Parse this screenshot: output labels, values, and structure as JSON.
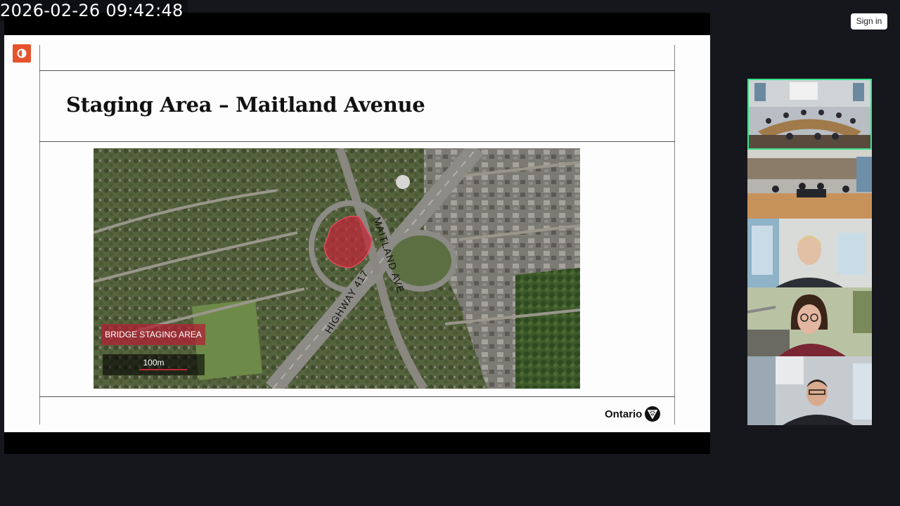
{
  "timestamp": "2026-02-26 09:42:48",
  "header": {
    "sign_in_label": "Sign in"
  },
  "slide": {
    "title": "Staging Area – Maitland Avenue",
    "map": {
      "legend_label": "BRIDGE STAGING AREA",
      "scale_label": "100m",
      "road_label_highway": "HIGHWAY 417",
      "road_label_maitland": "MAITLAND AVE"
    },
    "footer_logo_text": "Ontario"
  },
  "participants": [
    {
      "id": "room-wide",
      "active": true
    },
    {
      "id": "room-panel",
      "active": false
    },
    {
      "id": "participant-blonde-woman",
      "active": false
    },
    {
      "id": "participant-woman-glasses",
      "active": false
    },
    {
      "id": "participant-man-glasses",
      "active": false
    }
  ],
  "colors": {
    "active_speaker": "#37e38a",
    "staging_area": "#c0283a",
    "brand_badge": "#e5532c"
  }
}
